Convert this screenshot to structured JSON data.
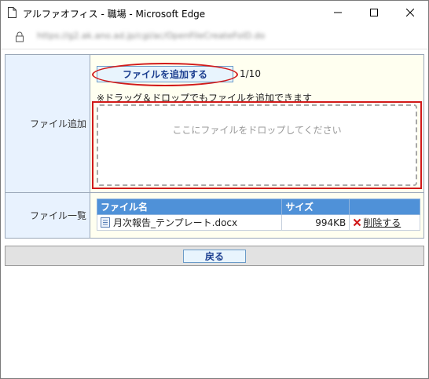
{
  "window": {
    "title": "アルファオフィス - 職場 - Microsoft Edge",
    "url": "https://g2.ak.ano.ad.jp/cgi/ac/OpenFileCreateFolD.do"
  },
  "form": {
    "add_label": "ファイル追加",
    "add_button_label": "ファイルを追加する",
    "file_count": "1/10",
    "hint": "※ドラッグ＆ドロップでもファイルを追加できます",
    "drop_zone_text": "ここにファイルをドロップしてください",
    "list_label": "ファイル一覧",
    "columns": [
      "ファイル名",
      "サイズ",
      ""
    ],
    "files": [
      {
        "name": "月次報告_テンプレート.docx",
        "size": "994KB",
        "action": "削除する"
      }
    ]
  },
  "footer": {
    "back_label": "戻る"
  },
  "colors": {
    "label_bg": "#e8f2fe",
    "value_bg": "#fffff0",
    "header_blue": "#4f91d8",
    "highlight_red": "#d11a1a"
  }
}
